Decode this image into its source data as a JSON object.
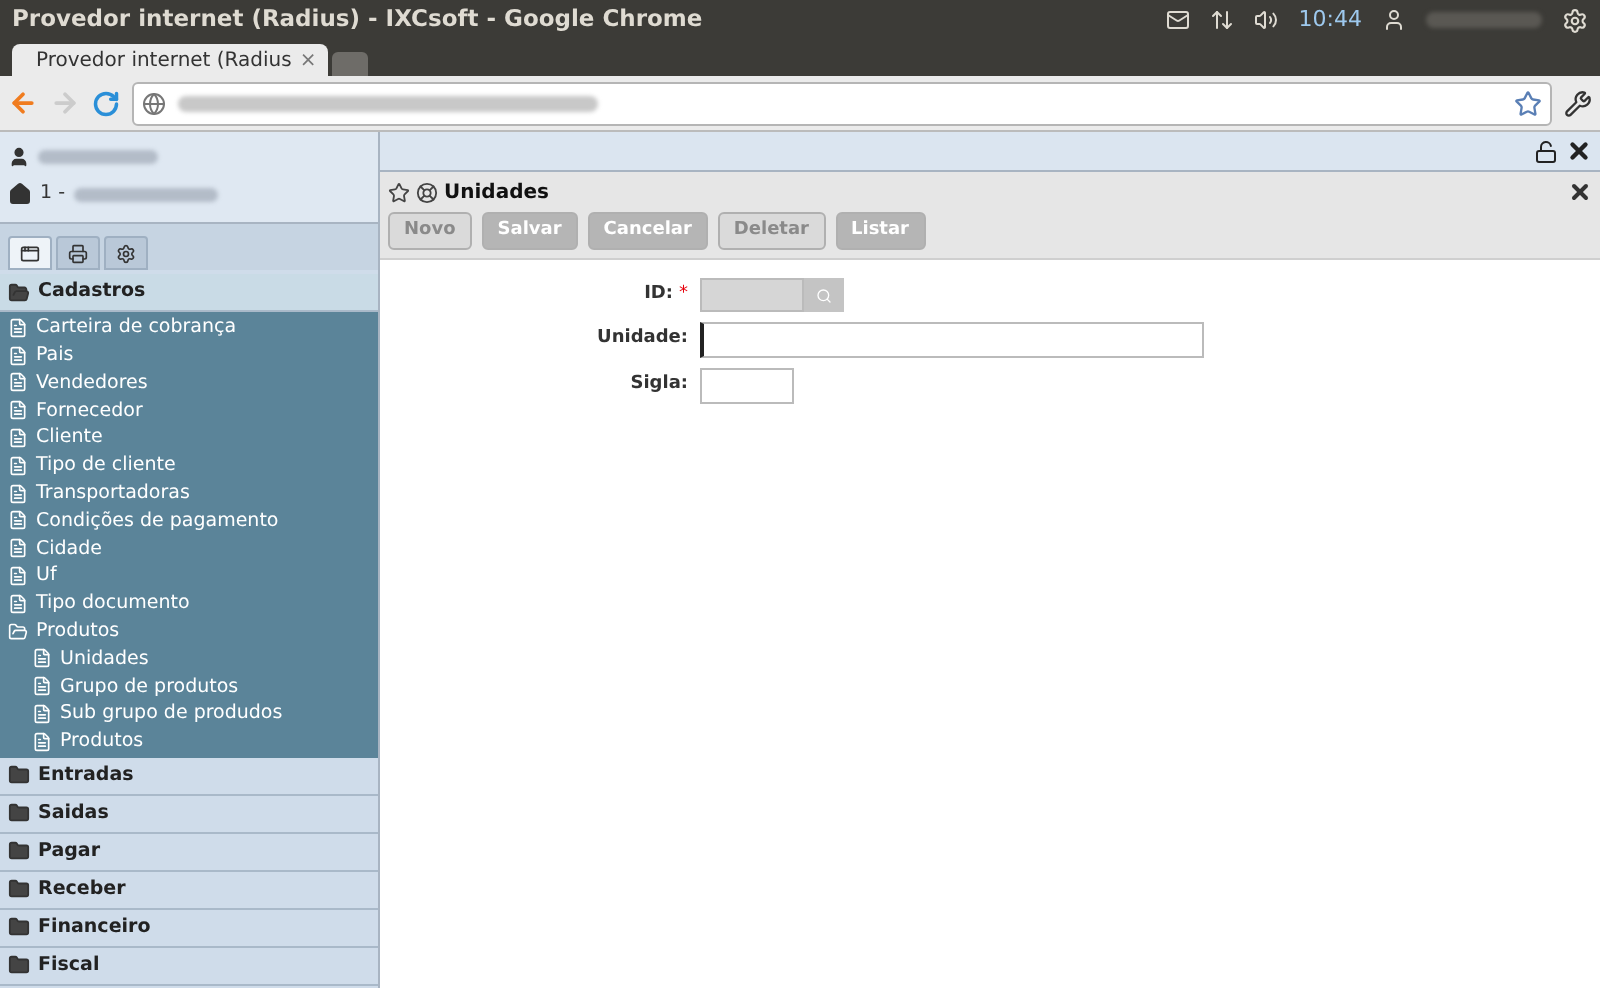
{
  "window": {
    "title": "Provedor internet (Radius) - IXCsoft - Google Chrome"
  },
  "system_tray": {
    "clock": "10:44"
  },
  "browser_tabs": [
    {
      "label": "Provedor internet (Radius",
      "close": "×",
      "selected": true
    },
    {
      "selected": false
    }
  ],
  "sidebar": {
    "company_prefix": "1 -",
    "tabs": [
      {
        "selected": true
      },
      {
        "selected": false
      },
      {
        "selected": false
      }
    ],
    "groups": [
      {
        "label": "Cadastros",
        "expanded": true,
        "items": [
          {
            "label": "Carteira de cobrança"
          },
          {
            "label": "Pais"
          },
          {
            "label": "Vendedores"
          },
          {
            "label": "Fornecedor"
          },
          {
            "label": "Cliente"
          },
          {
            "label": "Tipo de cliente"
          },
          {
            "label": "Transportadoras"
          },
          {
            "label": "Condições de pagamento"
          },
          {
            "label": "Cidade"
          },
          {
            "label": "Uf"
          },
          {
            "label": "Tipo documento"
          },
          {
            "label": "Produtos",
            "expanded": true,
            "children": [
              {
                "label": "Unidades"
              },
              {
                "label": "Grupo de produtos"
              },
              {
                "label": "Sub grupo de produdos"
              },
              {
                "label": "Produtos"
              }
            ]
          }
        ]
      },
      {
        "label": "Entradas",
        "expanded": false
      },
      {
        "label": "Saidas",
        "expanded": false
      },
      {
        "label": "Pagar",
        "expanded": false
      },
      {
        "label": "Receber",
        "expanded": false
      },
      {
        "label": "Financeiro",
        "expanded": false
      },
      {
        "label": "Fiscal",
        "expanded": false
      }
    ]
  },
  "panel": {
    "title": "Unidades",
    "buttons": [
      {
        "label": "Novo",
        "disabled": true
      },
      {
        "label": "Salvar",
        "disabled": false
      },
      {
        "label": "Cancelar",
        "disabled": false
      },
      {
        "label": "Deletar",
        "disabled": true
      },
      {
        "label": "Listar",
        "disabled": false
      }
    ],
    "fields": [
      {
        "label": "ID:",
        "required_mark": "*",
        "kind": "lookup",
        "disabled": true
      },
      {
        "label": "Unidade:",
        "kind": "text",
        "disabled": false
      },
      {
        "label": "Sigla:",
        "kind": "short",
        "disabled": false
      }
    ]
  }
}
